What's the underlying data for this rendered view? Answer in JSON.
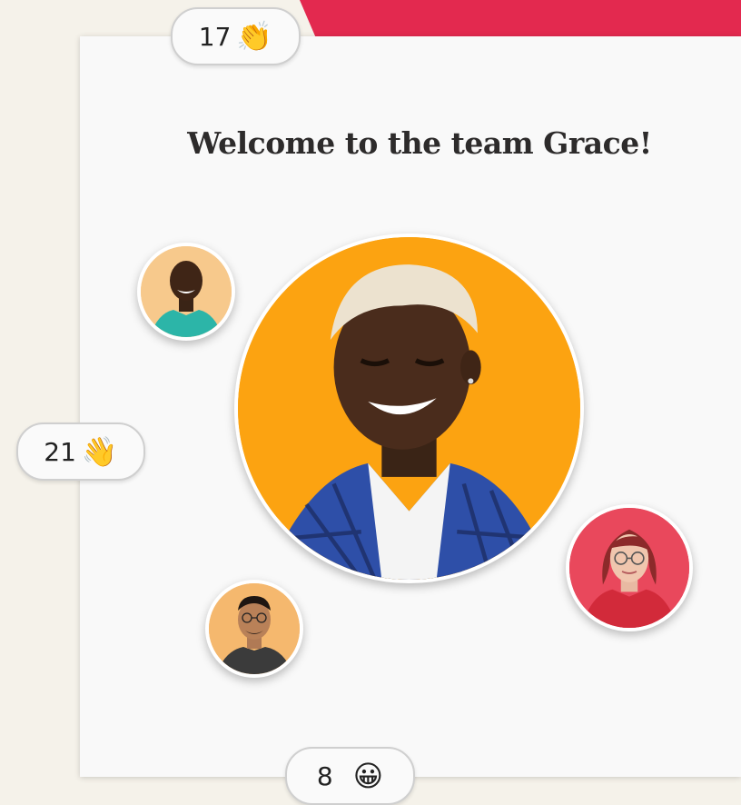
{
  "welcome": {
    "title": "Welcome to the team Grace!"
  },
  "reactions": [
    {
      "count": "17",
      "emoji": "👏",
      "icon": "clapping-hands-icon"
    },
    {
      "count": "21",
      "emoji": "👋",
      "icon": "waving-hand-icon"
    },
    {
      "count": "8",
      "emoji": "😀",
      "icon": "grinning-face-icon"
    }
  ],
  "colors": {
    "accent": "#e3294f",
    "main_avatar_bg": "#fca311",
    "card_bg": "#f9f9f9",
    "page_bg": "#f5f2ea"
  }
}
